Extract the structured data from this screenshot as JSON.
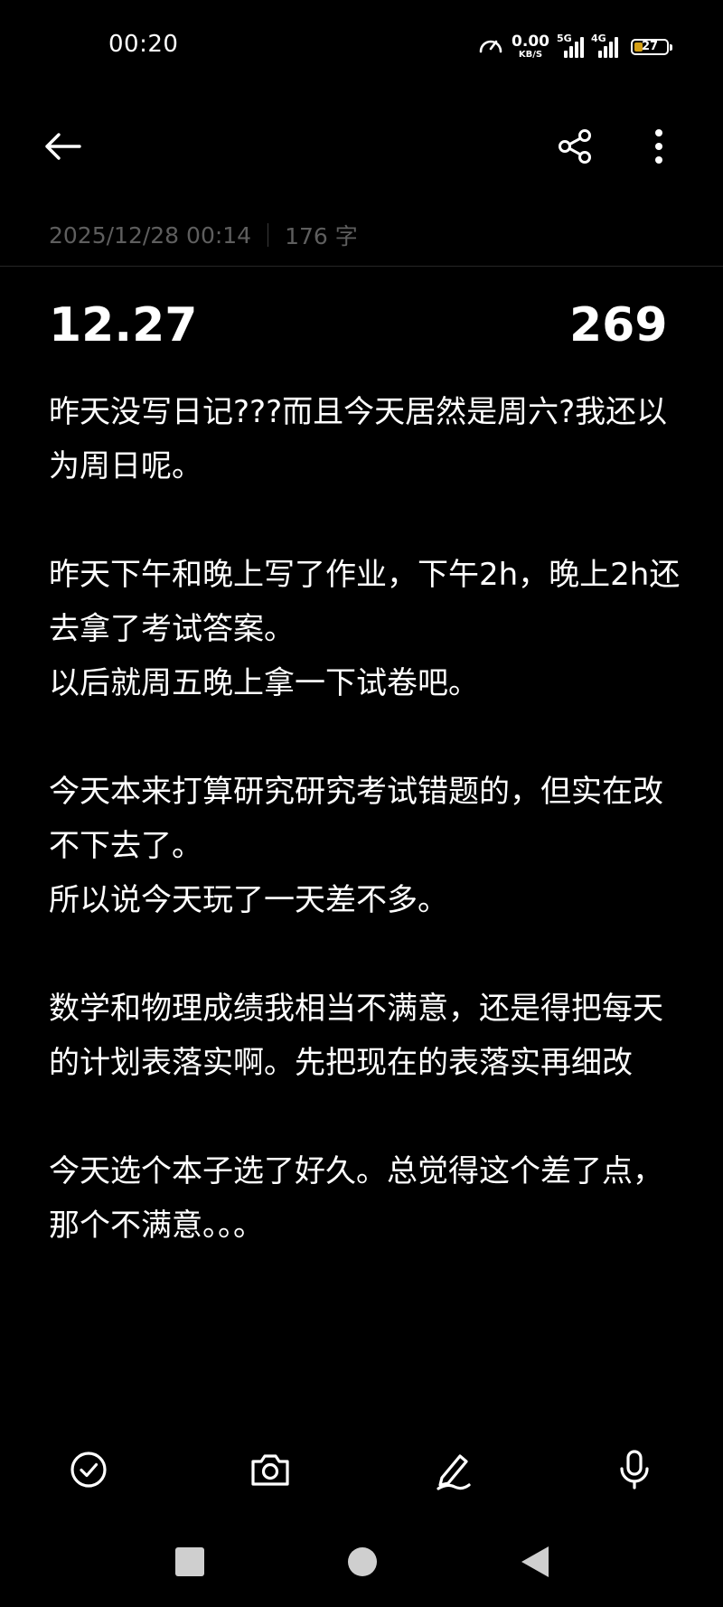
{
  "status_bar": {
    "time": "00:20",
    "net_speed_value": "0.00",
    "net_speed_unit": "KB/S",
    "signal_1_label": "5G",
    "signal_2_label": "4G",
    "battery_percent": "27",
    "battery_level": 0.27,
    "battery_color": "#d4a017"
  },
  "toolbar": {
    "back_icon": "arrow-left-icon",
    "share_icon": "share-icon",
    "more_icon": "more-vertical-icon"
  },
  "meta": {
    "datetime": "2025/12/28 00:14",
    "word_count": "176 字"
  },
  "note": {
    "title": "12.27",
    "number": "269",
    "paragraphs": [
      "昨天没写日记???而且今天居然是周六?我还以为周日呢。",
      "",
      "昨天下午和晚上写了作业，下午2h，晚上2h还去拿了考试答案。",
      "以后就周五晚上拿一下试卷吧。",
      "",
      "今天本来打算研究研究考试错题的，但实在改不下去了。",
      "所以说今天玩了一天差不多。",
      "",
      "数学和物理成绩我相当不满意，还是得把每天的计划表落实啊。先把现在的表落实再细改",
      "",
      "今天选个本子选了好久。总觉得这个差了点，那个不满意。。。"
    ]
  },
  "bottom_toolbar": {
    "items": [
      "checklist-icon",
      "camera-icon",
      "pen-icon",
      "microphone-icon"
    ]
  },
  "system_nav": {
    "items": [
      "recents-icon",
      "home-icon",
      "back-triangle-icon"
    ]
  }
}
